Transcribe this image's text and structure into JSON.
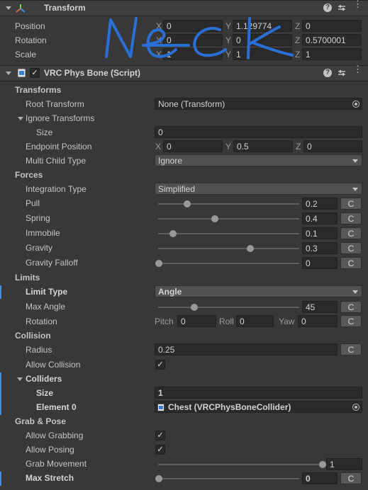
{
  "transform": {
    "title": "Transform",
    "position": {
      "label": "Position",
      "x": "0",
      "y": "1.129774",
      "z": "0"
    },
    "rotation": {
      "label": "Rotation",
      "x": "0",
      "y": "0",
      "z": "0.5700001"
    },
    "scale": {
      "label": "Scale",
      "x": "1",
      "y": "1",
      "z": "1"
    },
    "axis_x": "X",
    "axis_y": "Y",
    "axis_z": "Z",
    "handwriting": "Neck"
  },
  "physbone": {
    "title": "VRC Phys Bone (Script)",
    "transforms": {
      "header": "Transforms",
      "root_label": "Root Transform",
      "root_value": "None (Transform)",
      "ignore_label": "Ignore Transforms",
      "size_label": "Size",
      "size_value": "0",
      "endpoint_label": "Endpoint Position",
      "endpoint_x": "0",
      "endpoint_y": "0.5",
      "endpoint_z": "0",
      "multichild_label": "Multi Child Type",
      "multichild_value": "Ignore"
    },
    "forces": {
      "header": "Forces",
      "integration_label": "Integration Type",
      "integration_value": "Simplified",
      "pull_label": "Pull",
      "pull_value": "0.2",
      "pull_fraction": 0.2,
      "spring_label": "Spring",
      "spring_value": "0.4",
      "spring_fraction": 0.4,
      "immobile_label": "Immobile",
      "immobile_value": "0.1",
      "immobile_fraction": 0.1,
      "gravity_label": "Gravity",
      "gravity_value": "0.3",
      "gravity_fraction": 0.65,
      "falloff_label": "Gravity Falloff",
      "falloff_value": "0",
      "falloff_fraction": 0
    },
    "limits": {
      "header": "Limits",
      "type_label": "Limit Type",
      "type_value": "Angle",
      "maxangle_label": "Max Angle",
      "maxangle_value": "45",
      "maxangle_fraction": 0.25,
      "rotation_label": "Rotation",
      "pitch_label": "Pitch",
      "pitch_value": "0",
      "roll_label": "Roll",
      "roll_value": "0",
      "yaw_label": "Yaw",
      "yaw_value": "0"
    },
    "collision": {
      "header": "Collision",
      "radius_label": "Radius",
      "radius_value": "0.25",
      "allow_label": "Allow Collision",
      "allow_checked": true,
      "colliders_label": "Colliders",
      "size_label": "Size",
      "size_value": "1",
      "element_label": "Element 0",
      "element_value": "Chest (VRCPhysBoneCollider)"
    },
    "grab": {
      "header": "Grab & Pose",
      "grabbing_label": "Allow Grabbing",
      "grabbing_checked": true,
      "posing_label": "Allow Posing",
      "posing_checked": true,
      "movement_label": "Grab Movement",
      "movement_value": "1",
      "movement_fraction": 1,
      "stretch_label": "Max Stretch",
      "stretch_value": "0",
      "stretch_fraction": 0
    },
    "reset_label": "C"
  },
  "colors": {
    "accent": "#4a8ad6",
    "handwriting": "#2a6fd6",
    "background": "#383838"
  }
}
